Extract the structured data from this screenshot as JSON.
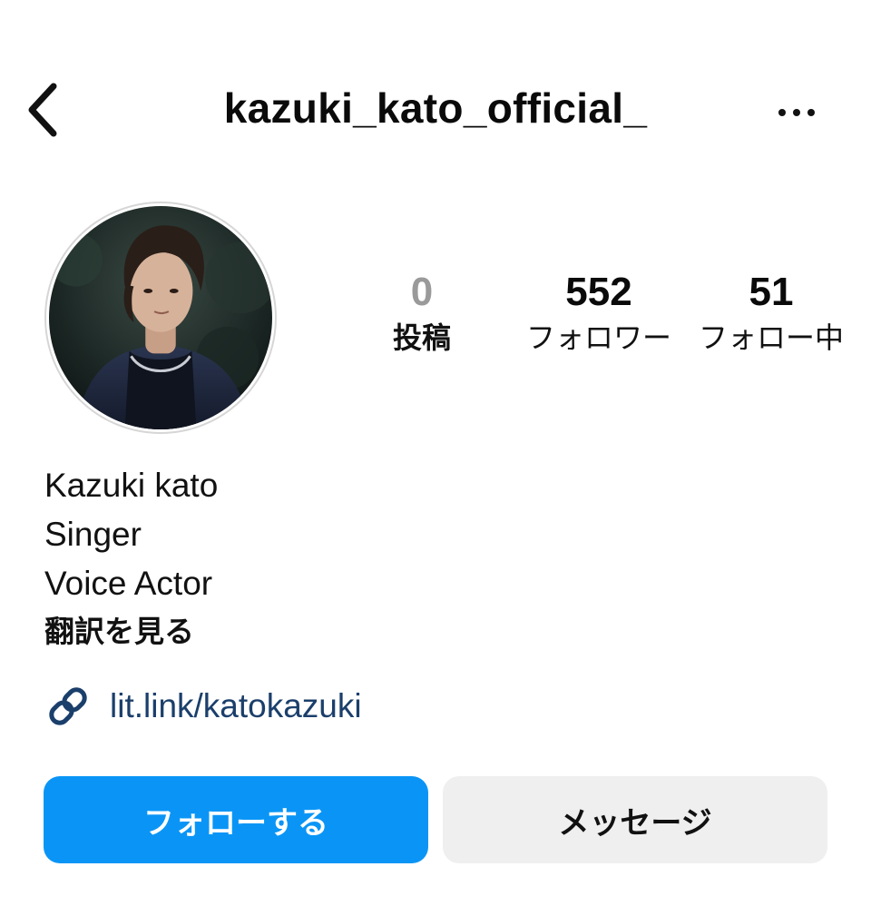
{
  "header": {
    "username": "kazuki_kato_official_",
    "back_icon": "chevron-left-icon",
    "more_icon": "more-horizontal-icon"
  },
  "avatar": {
    "icon": "profile-photo"
  },
  "stats": [
    {
      "value": "0",
      "label": "投稿"
    },
    {
      "value": "552",
      "label": "フォロワー"
    },
    {
      "value": "51",
      "label": "フォロー中"
    }
  ],
  "bio": {
    "name": "Kazuki kato",
    "lines": [
      "Singer",
      "Voice Actor"
    ],
    "translate": "翻訳を見る"
  },
  "link": {
    "icon": "link-icon",
    "text": "lit.link/katokazuki"
  },
  "actions": {
    "follow": "フォローする",
    "message": "メッセージ"
  },
  "colors": {
    "follow_button": "#0a95f6",
    "message_button": "#efefef",
    "link_text": "#1b3f6b",
    "posts_count": "#9a9a9a"
  }
}
